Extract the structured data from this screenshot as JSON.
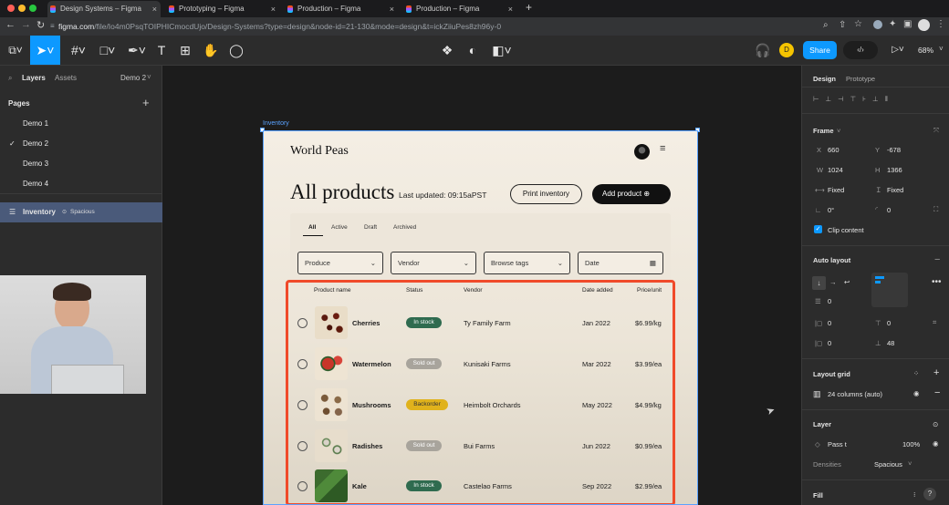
{
  "browser": {
    "tabs": [
      "Design Systems – Figma",
      "Prototyping – Figma",
      "Production – Figma",
      "Production – Figma"
    ],
    "new_tab": "+",
    "url_domain": "figma.com",
    "url_path": "/file/Io4m0PsqTOIPHICmocdUjo/Design-Systems?type=design&node-id=21-130&mode=design&t=ickZiiuPes8zh96y-0"
  },
  "toolbar": {
    "share_label": "Share",
    "zoom": "68%",
    "avatar_initial": "D"
  },
  "left_panel": {
    "tab_layers": "Layers",
    "tab_assets": "Assets",
    "page_selector": "Demo 2",
    "pages_heading": "Pages",
    "pages": [
      "Demo 1",
      "Demo 2",
      "Demo 3",
      "Demo 4"
    ],
    "selected_page_check": "✓",
    "layer_name": "Inventory",
    "layer_badge": "Spacious"
  },
  "canvas": {
    "frame_label": "Inventory",
    "brand": "World Peas",
    "heading": "All products",
    "last_updated": "Last updated: 09:15aPST",
    "print_btn": "Print inventory",
    "add_btn": "Add product",
    "filter_tabs": [
      "All",
      "Active",
      "Draft",
      "Archived"
    ],
    "dropdowns": [
      "Produce",
      "Vendor",
      "Browse tags",
      "Date"
    ],
    "columns": [
      "Product name",
      "Status",
      "Vendor",
      "Date added",
      "Price/unit"
    ],
    "rows": [
      {
        "name": "Cherries",
        "status": "In stock",
        "vendor": "Ty Family Farm",
        "date": "Jan 2022",
        "price": "$6.99/kg"
      },
      {
        "name": "Watermelon",
        "status": "Sold out",
        "vendor": "Kunisaki Farms",
        "date": "Mar 2022",
        "price": "$3.99/ea"
      },
      {
        "name": "Mushrooms",
        "status": "Backorder",
        "vendor": "Heimbolt Orchards",
        "date": "May 2022",
        "price": "$4.99/kg"
      },
      {
        "name": "Radishes",
        "status": "Sold out",
        "vendor": "Bui Farms",
        "date": "Jun 2022",
        "price": "$0.99/ea"
      },
      {
        "name": "Kale",
        "status": "In stock",
        "vendor": "Castelao Farms",
        "date": "Sep 2022",
        "price": "$2.99/ea"
      }
    ],
    "status_colors": {
      "In stock": "#2f6b4f",
      "Sold out": "#a8a49c",
      "Backorder": "#e0b21c"
    },
    "highlight_color": "#f04a2a"
  },
  "right_panel": {
    "tab_design": "Design",
    "tab_prototype": "Prototype",
    "frame_label": "Frame",
    "x_label": "X",
    "x_value": "660",
    "y_label": "Y",
    "y_value": "-678",
    "w_label": "W",
    "w_value": "1024",
    "h_label": "H",
    "h_value": "1366",
    "w_mode": "Fixed",
    "h_mode": "Fixed",
    "rotation": "0°",
    "radius": "0",
    "clip_content": "Clip content",
    "auto_layout": "Auto layout",
    "spacing": "0",
    "pad_l": "0",
    "pad_t": "0",
    "pad_r": "0",
    "pad_b": "48",
    "layout_grid": "Layout grid",
    "grid_desc": "24 columns (auto)",
    "layer_label": "Layer",
    "pass_through": "Pass t",
    "opacity": "100%",
    "densities_label": "Densities",
    "densities_value": "Spacious",
    "fill_label": "Fill"
  }
}
